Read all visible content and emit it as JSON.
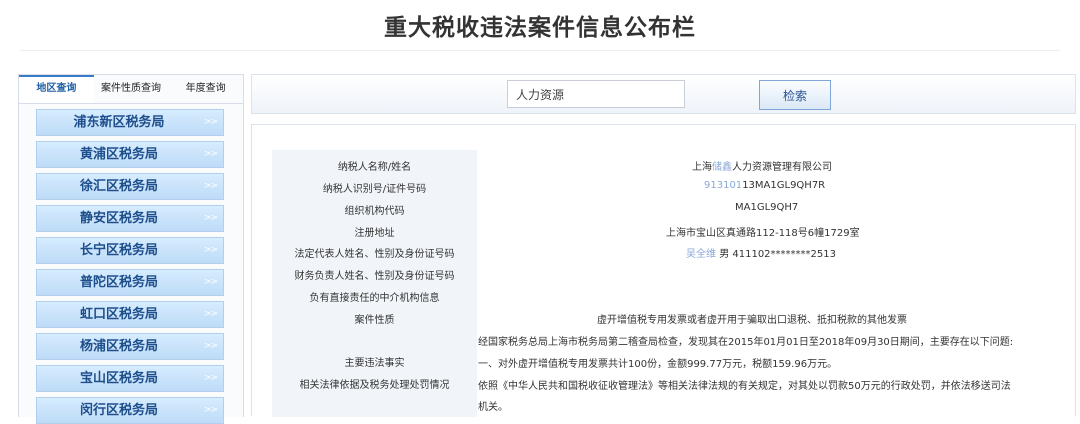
{
  "page_title": "重大税收违法案件信息公布栏",
  "tabs": [
    {
      "label": "地区查询",
      "active": true
    },
    {
      "label": "案件性质查询",
      "active": false
    },
    {
      "label": "年度查询",
      "active": false
    }
  ],
  "bureaus": [
    "浦东新区税务局",
    "黄浦区税务局",
    "徐汇区税务局",
    "静安区税务局",
    "长宁区税务局",
    "普陀区税务局",
    "虹口区税务局",
    "杨浦区税务局",
    "宝山区税务局",
    "闵行区税务局"
  ],
  "bureau_arrow": ">>",
  "search": {
    "value": "人力资源",
    "button_label": "检索"
  },
  "details": {
    "taxpayer_name": {
      "label": "纳税人名称/姓名",
      "value_pre": "上海",
      "value_blur": "储鑫",
      "value_post": "人力资源管理有限公司"
    },
    "taxpayer_id": {
      "label": "纳税人识别号/证件号码",
      "value_blur": "913101",
      "value_post": "13MA1GL9QH7R"
    },
    "org_code": {
      "label": "组织机构代码",
      "value": "MA1GL9QH7"
    },
    "reg_address": {
      "label": "注册地址",
      "value": "上海市宝山区真通路112-118号6幢1729室"
    },
    "legal_rep": {
      "label": "法定代表人姓名、性别及身份证号码",
      "value_blur": "吴全维",
      "value_post": "男  411102********2513"
    },
    "finance_head": {
      "label": "财务负责人姓名、性别及身份证号码"
    },
    "intermediary": {
      "label": "负有直接责任的中介机构信息"
    },
    "case_nature": {
      "label": "案件性质",
      "value": "虚开增值税专用发票或者虚开用于骗取出口退税、抵扣税款的其他发票"
    },
    "main_facts": {
      "label": "主要违法事实",
      "line1": "经国家税务总局上海市税务局第二稽查局检查，发现其在2015年01月01日至2018年09月30日期间，主要存在以下问题:",
      "line2": "一、对外虚开增值税专用发票共计100份，金额999.77万元，税额159.96万元。"
    },
    "penalty": {
      "label": "相关法律依据及税务处理处罚情况",
      "line1": "依照《中华人民共和国税收征收管理法》等相关法律法规的有关规定，对其处以罚款50万元的行政处罚，并依法移送司法",
      "line2": "机关。"
    }
  }
}
